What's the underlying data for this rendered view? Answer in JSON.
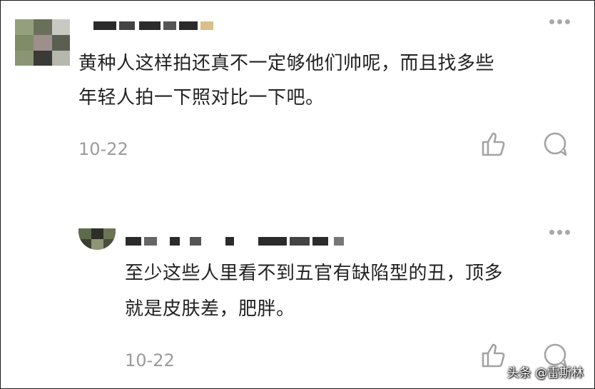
{
  "comments": [
    {
      "text_line1": "黄种人这样拍还真不一定够他们帅呢，而且找多些",
      "text_line2": "年轻人拍一下照对比一下吧。",
      "date": "10-22"
    },
    {
      "text_line1": "至少这些人里看不到五官有缺陷型的丑，顶多",
      "text_line2": "就是皮肤差，肥胖。",
      "date": "10-22"
    }
  ],
  "icons": {
    "more": "more-dots-icon",
    "like": "thumbs-up-icon",
    "reply": "comment-bubble-icon"
  },
  "colors": {
    "text": "#222222",
    "date": "#9b9b9b",
    "icon": "#a3a3a3"
  },
  "watermark": "头条 @雷斯林"
}
